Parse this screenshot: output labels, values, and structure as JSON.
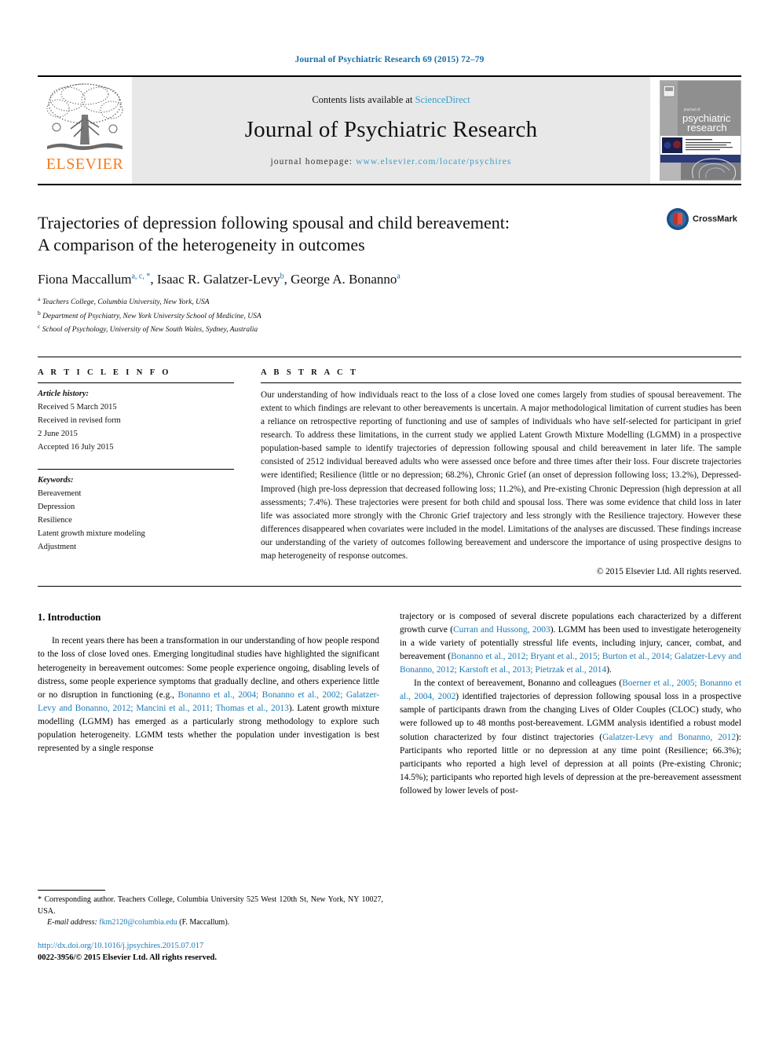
{
  "running_head": "Journal of Psychiatric Research 69 (2015) 72–79",
  "masthead": {
    "publisher_name": "ELSEVIER",
    "contents_prefix": "Contents lists available at ",
    "sciencedirect": "ScienceDirect",
    "journal_title": "Journal of Psychiatric Research",
    "homepage_prefix": "journal homepage: ",
    "homepage_url": "www.elsevier.com/locate/psychires",
    "cover_title_small": "journal of",
    "cover_title_line1": "psychiatric",
    "cover_title_line2": "research"
  },
  "article": {
    "title_line1": "Trajectories of depression following spousal and child bereavement:",
    "title_line2": "A comparison of the heterogeneity in outcomes",
    "crossmark_label": "CrossMark",
    "authors": [
      {
        "name": "Fiona Maccallum",
        "marks": "a, c, *"
      },
      {
        "name": "Isaac R. Galatzer-Levy",
        "marks": "b"
      },
      {
        "name": "George A. Bonanno",
        "marks": "a"
      }
    ],
    "affiliations": [
      {
        "mark": "a",
        "text": "Teachers College, Columbia University, New York, USA"
      },
      {
        "mark": "b",
        "text": "Department of Psychiatry, New York University School of Medicine, USA"
      },
      {
        "mark": "c",
        "text": "School of Psychology, University of New South Wales, Sydney, Australia"
      }
    ]
  },
  "article_info": {
    "heading": "A R T I C L E   I N F O",
    "history_label": "Article history:",
    "history": [
      "Received 5 March 2015",
      "Received in revised form",
      "2 June 2015",
      "Accepted 16 July 2015"
    ],
    "keywords_label": "Keywords:",
    "keywords": [
      "Bereavement",
      "Depression",
      "Resilience",
      "Latent growth mixture modeling",
      "Adjustment"
    ]
  },
  "abstract": {
    "heading": "A B S T R A C T",
    "text": "Our understanding of how individuals react to the loss of a close loved one comes largely from studies of spousal bereavement. The extent to which findings are relevant to other bereavements is uncertain. A major methodological limitation of current studies has been a reliance on retrospective reporting of functioning and use of samples of individuals who have self-selected for participant in grief research. To address these limitations, in the current study we applied Latent Growth Mixture Modelling (LGMM) in a prospective population-based sample to identify trajectories of depression following spousal and child bereavement in later life. The sample consisted of 2512 individual bereaved adults who were assessed once before and three times after their loss. Four discrete trajectories were identified; Resilience (little or no depression; 68.2%), Chronic Grief (an onset of depression following loss; 13.2%), Depressed-Improved (high pre-loss depression that decreased following loss; 11.2%), and Pre-existing Chronic Depression (high depression at all assessments; 7.4%). These trajectories were present for both child and spousal loss. There was some evidence that child loss in later life was associated more strongly with the Chronic Grief trajectory and less strongly with the Resilience trajectory. However these differences disappeared when covariates were included in the model. Limitations of the analyses are discussed. These findings increase our understanding of the variety of outcomes following bereavement and underscore the importance of using prospective designs to map heterogeneity of response outcomes.",
    "copyright": "© 2015 Elsevier Ltd. All rights reserved."
  },
  "body": {
    "section_title": "1. Introduction",
    "left_para_1_a": "In recent years there has been a transformation in our understanding of how people respond to the loss of close loved ones. Emerging longitudinal studies have highlighted the significant heterogeneity in bereavement outcomes: Some people experience ongoing, disabling levels of distress, some people experience symptoms that gradually decline, and others experience little or no disruption in functioning (e.g., ",
    "left_cite_1": "Bonanno et al., 2004; Bonanno et al., 2002; Galatzer-Levy and Bonanno, 2012; Mancini et al., 2011; Thomas et al., 2013",
    "left_para_1_b": "). Latent growth mixture modelling (LGMM) has emerged as a particularly strong methodology to explore such population heterogeneity. LGMM tests whether the population under investigation is best represented by a single response",
    "right_para_1_a": "trajectory or is composed of several discrete populations each characterized by a different growth curve (",
    "right_cite_1": "Curran and Hussong, 2003",
    "right_para_1_b": "). LGMM has been used to investigate heterogeneity in a wide variety of potentially stressful life events, including injury, cancer, combat, and bereavement (",
    "right_cite_2": "Bonanno et al., 2012; Bryant et al., 2015; Burton et al., 2014; Galatzer-Levy and Bonanno, 2012; Karstoft et al., 2013; Pietrzak et al., 2014",
    "right_para_1_c": ").",
    "right_para_2_a": "In the context of bereavement, Bonanno and colleagues (",
    "right_cite_3": "Boerner et al., 2005; Bonanno et al., 2004, 2002",
    "right_para_2_b": ") identified trajectories of depression following spousal loss in a prospective sample of participants drawn from the changing Lives of Older Couples (CLOC) study, who were followed up to 48 months post-bereavement. LGMM analysis identified a robust model solution characterized by four distinct trajectories (",
    "right_cite_4": "Galatzer-Levy and Bonanno, 2012",
    "right_para_2_c": "): Participants who reported little or no depression at any time point (Resilience; 66.3%); participants who reported a high level of depression at all points (Pre-existing Chronic; 14.5%); participants who reported high levels of depression at the pre-bereavement assessment followed by lower levels of post-"
  },
  "footer": {
    "corresponding_marker": "*",
    "corresponding_text": "Corresponding author. Teachers College, Columbia University 525 West 120th St, New York, NY 10027, USA.",
    "email_label": "E-mail address:",
    "email": "fkm2120@columbia.edu",
    "email_suffix": "(F. Maccallum).",
    "doi": "http://dx.doi.org/10.1016/j.jpsychires.2015.07.017",
    "issn_line": "0022-3956/© 2015 Elsevier Ltd. All rights reserved."
  },
  "colors": {
    "link_blue": "#1a7bb9",
    "sciencedirect_blue": "#3b9ec9",
    "elsevier_orange": "#f47c20",
    "running_head_blue": "#1a6ea8"
  }
}
